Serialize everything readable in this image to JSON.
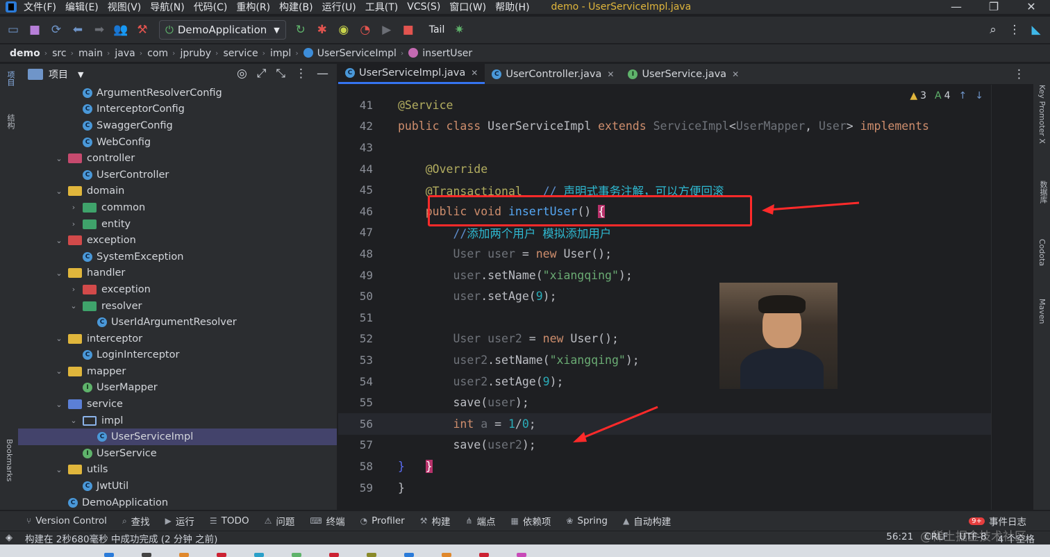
{
  "menubar": {
    "items": [
      "文件(F)",
      "编辑(E)",
      "视图(V)",
      "导航(N)",
      "代码(C)",
      "重构(R)",
      "构建(B)",
      "运行(U)",
      "工具(T)",
      "VCS(S)",
      "窗口(W)",
      "帮助(H)"
    ],
    "window_title": "demo - UserServiceImpl.java"
  },
  "toolbar": {
    "run_config": "DemoApplication",
    "tail_label": "Tail"
  },
  "breadcrumb": [
    "demo",
    "src",
    "main",
    "java",
    "com",
    "jpruby",
    "service",
    "impl",
    "UserServiceImpl",
    "insertUser"
  ],
  "left_stripe": {
    "project": "项目",
    "structure": "结构",
    "bookmarks": "Bookmarks"
  },
  "right_stripe": {
    "key_promoter": "Key Promoter X",
    "database": "数据库",
    "codota": "Codota",
    "maven": "Maven"
  },
  "project_panel": {
    "title": "项目",
    "tree": [
      {
        "label": "ArgumentResolverConfig",
        "kind": "class",
        "depth": 3,
        "arrow": ""
      },
      {
        "label": "InterceptorConfig",
        "kind": "class",
        "depth": 3,
        "arrow": ""
      },
      {
        "label": "SwaggerConfig",
        "kind": "class",
        "depth": 3,
        "arrow": ""
      },
      {
        "label": "WebConfig",
        "kind": "class",
        "depth": 3,
        "arrow": ""
      },
      {
        "label": "controller",
        "kind": "folder-ctrl",
        "depth": 2,
        "arrow": "down"
      },
      {
        "label": "UserController",
        "kind": "class",
        "depth": 3,
        "arrow": ""
      },
      {
        "label": "domain",
        "kind": "folder",
        "depth": 2,
        "arrow": "down"
      },
      {
        "label": "common",
        "kind": "folder-green",
        "depth": 3,
        "arrow": "right"
      },
      {
        "label": "entity",
        "kind": "folder-green",
        "depth": 3,
        "arrow": "right"
      },
      {
        "label": "exception",
        "kind": "folder-red",
        "depth": 2,
        "arrow": "down"
      },
      {
        "label": "SystemException",
        "kind": "class",
        "depth": 3,
        "arrow": ""
      },
      {
        "label": "handler",
        "kind": "folder",
        "depth": 2,
        "arrow": "down"
      },
      {
        "label": "exception",
        "kind": "folder-red",
        "depth": 3,
        "arrow": "right"
      },
      {
        "label": "resolver",
        "kind": "folder-green",
        "depth": 3,
        "arrow": "down"
      },
      {
        "label": "UserIdArgumentResolver",
        "kind": "class",
        "depth": 4,
        "arrow": ""
      },
      {
        "label": "interceptor",
        "kind": "folder",
        "depth": 2,
        "arrow": "down"
      },
      {
        "label": "LoginInterceptor",
        "kind": "class",
        "depth": 3,
        "arrow": ""
      },
      {
        "label": "mapper",
        "kind": "folder",
        "depth": 2,
        "arrow": "down"
      },
      {
        "label": "UserMapper",
        "kind": "iface",
        "depth": 3,
        "arrow": ""
      },
      {
        "label": "service",
        "kind": "folder-blue",
        "depth": 2,
        "arrow": "down"
      },
      {
        "label": "impl",
        "kind": "folder-outline",
        "depth": 3,
        "arrow": "down"
      },
      {
        "label": "UserServiceImpl",
        "kind": "class",
        "depth": 4,
        "arrow": "",
        "selected": true
      },
      {
        "label": "UserService",
        "kind": "iface",
        "depth": 3,
        "arrow": ""
      },
      {
        "label": "utils",
        "kind": "folder",
        "depth": 2,
        "arrow": "down"
      },
      {
        "label": "JwtUtil",
        "kind": "class-run",
        "depth": 3,
        "arrow": ""
      },
      {
        "label": "DemoApplication",
        "kind": "class",
        "depth": 2,
        "arrow": ""
      }
    ]
  },
  "editor": {
    "tabs": [
      {
        "label": "UserServiceImpl.java",
        "kind": "class",
        "active": true
      },
      {
        "label": "UserController.java",
        "kind": "class",
        "active": false
      },
      {
        "label": "UserService.java",
        "kind": "iface",
        "active": false
      }
    ],
    "inspections": {
      "warnings": "3",
      "typos": "4"
    },
    "lines": [
      {
        "n": "41",
        "html": "<span class=\"ann\">@Service</span>"
      },
      {
        "n": "42",
        "html": "<span class=\"kw\">public class</span> <span class=\"cls\">UserServiceImpl</span> <span class=\"kw\">extends</span> <span class=\"type\">ServiceImpl</span>&lt;<span class=\"type\">UserMapper</span>, <span class=\"type\">User</span>&gt; <span class=\"kw\">implements</span>"
      },
      {
        "n": "43",
        "html": ""
      },
      {
        "n": "44",
        "html": "    <span class=\"ann\">@Override</span>"
      },
      {
        "n": "45",
        "html": "    <span class=\"ann\">@Transactional</span>   <span class=\"cmt\">// </span><span class=\"cmt-cn\">声明式事务注解，可以方便回滚</span>"
      },
      {
        "n": "46",
        "html": "    <span class=\"kw\">public void</span> <span class=\"fn\">insertUser</span>() <span class=\"brace-hl\">{</span>"
      },
      {
        "n": "47",
        "html": "        <span class=\"cmt\">//</span><span class=\"cmt-cn\">添加两个用户 模拟添加用户</span>"
      },
      {
        "n": "48",
        "html": "        <span class=\"type\">User</span> <span class=\"type\">user</span> = <span class=\"kw\">new</span> User();"
      },
      {
        "n": "49",
        "html": "        <span class=\"type\">user</span>.setName(<span class=\"str\">\"xiangqing\"</span>);"
      },
      {
        "n": "50",
        "html": "        <span class=\"type\">user</span>.setAge(<span class=\"num\">9</span>);"
      },
      {
        "n": "51",
        "html": ""
      },
      {
        "n": "52",
        "html": "        <span class=\"type\">User</span> <span class=\"type\">user2</span> = <span class=\"kw\">new</span> User();"
      },
      {
        "n": "53",
        "html": "        <span class=\"type\">user2</span>.setName(<span class=\"str\">\"xiangqing\"</span>);"
      },
      {
        "n": "54",
        "html": "        <span class=\"type\">user2</span>.setAge(<span class=\"num\">9</span>);"
      },
      {
        "n": "55",
        "html": "        save(<span class=\"type\">user</span>);"
      },
      {
        "n": "56",
        "html": "        <span class=\"kw\">int</span> <span class=\"type\">a</span> = <span class=\"num\">1</span>/<span class=\"num\">0</span>;"
      },
      {
        "n": "57",
        "html": "        save(<span class=\"type\">user2</span>);"
      },
      {
        "n": "58",
        "html": "<span style=\"color:#5b6df6\">}</span>   <span class=\"brace-hl\">}</span>"
      },
      {
        "n": "59",
        "html": "}"
      }
    ]
  },
  "bottombar": {
    "items": [
      "Version Control",
      "查找",
      "运行",
      "TODO",
      "问题",
      "终端",
      "Profiler",
      "构建",
      "端点",
      "依赖项",
      "Spring",
      "自动构建"
    ],
    "event_count": "9+",
    "event_label": "事件日志"
  },
  "status": {
    "message": "构建在 2秒680毫秒 中成功完成 (2 分钟 之前)",
    "position": "56:21",
    "line_sep": "CRLF",
    "encoding": "UTF-8",
    "indent": "4 个空格",
    "watermark": "@稀土掘金技术社区"
  }
}
